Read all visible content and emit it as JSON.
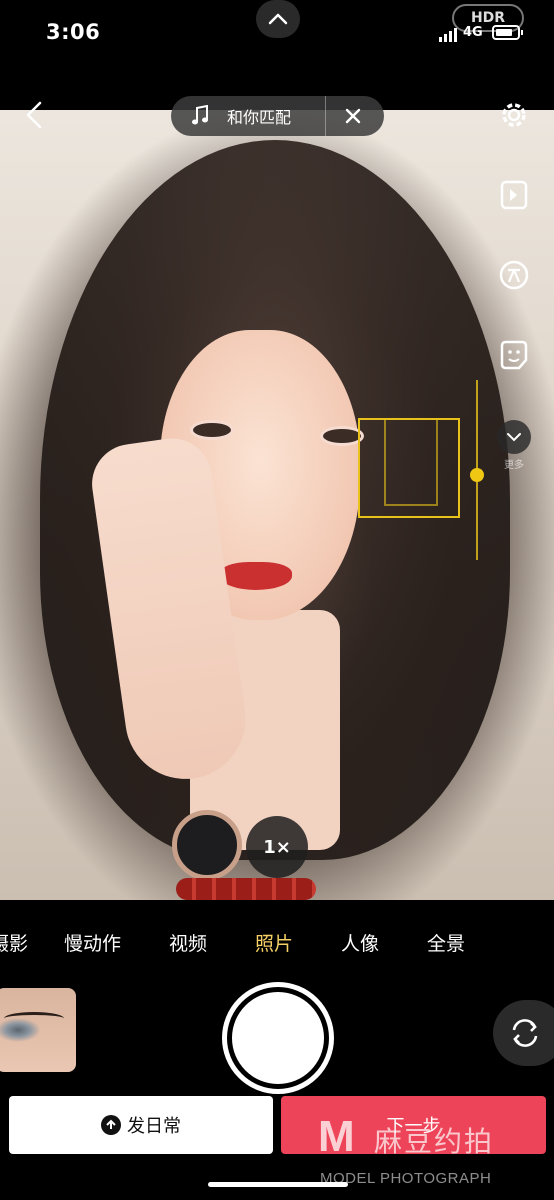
{
  "status_bar": {
    "time": "3:06",
    "hdr": "HDR",
    "network": "4G",
    "icons": [
      "chevron-up-icon",
      "signal-icon",
      "battery-icon"
    ]
  },
  "top_bar": {
    "music_label": "和你匹配",
    "icons": [
      "back-icon",
      "music-note-icon",
      "close-icon"
    ]
  },
  "right_toolbar": {
    "items": [
      {
        "icon": "settings-icon"
      },
      {
        "icon": "flip-frame-icon"
      },
      {
        "icon": "text-icon"
      },
      {
        "icon": "sticker-icon"
      },
      {
        "icon": "chevron-down-icon",
        "label": "更多"
      }
    ]
  },
  "zoom_label": "1×",
  "modes": {
    "items": [
      "摄影",
      "慢动作",
      "视频",
      "照片",
      "人像",
      "全景"
    ],
    "active": "照片"
  },
  "bottom": {
    "daily_label": "发日常",
    "next_label": "下一步"
  },
  "watermark": {
    "logo": "M",
    "cn": "麻豆约拍",
    "en": "MODEL PHOTOGRAPH"
  },
  "colors": {
    "accent_mode": "#f5d166",
    "next_button": "#ee4459",
    "focus": "#e8c21a"
  }
}
